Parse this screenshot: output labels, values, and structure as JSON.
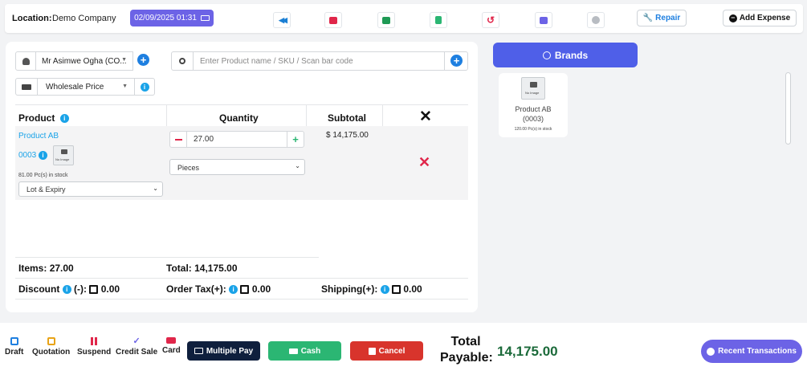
{
  "header": {
    "location_label": "Location:",
    "location_value": "Demo Company",
    "datetime": "02/09/2025 01:31",
    "repair_label": "Repair",
    "add_expense_label": "Add Expense"
  },
  "customer": {
    "selected": "Mr Asimwe Ogha (CO..."
  },
  "search": {
    "placeholder": "Enter Product name / SKU / Scan bar code"
  },
  "price_group": {
    "selected": "Wholesale Price"
  },
  "table": {
    "headers": {
      "product": "Product",
      "quantity": "Quantity",
      "subtotal": "Subtotal"
    },
    "rows": [
      {
        "name": "Product AB",
        "sku": "0003",
        "no_image": "No Image",
        "stock": "81.00 Pc(s) in stock",
        "lot": "Lot & Expiry",
        "quantity": "27.00",
        "unit": "Pieces",
        "subtotal": "$ 14,175.00"
      }
    ]
  },
  "summary": {
    "items_label": "Items:",
    "items_value": "27.00",
    "total_label": "Total:",
    "total_value": "14,175.00",
    "discount_label": "Discount",
    "discount_suffix": "(-):",
    "discount_value": "0.00",
    "tax_label": "Order Tax(+):",
    "tax_value": "0.00",
    "shipping_label": "Shipping(+):",
    "shipping_value": "0.00"
  },
  "brands": {
    "button_label": "Brands",
    "products": [
      {
        "name": "Product AB",
        "sku": "(0003)",
        "stock": "120.00 Pc(s) in stock",
        "no_image": "No Image"
      }
    ]
  },
  "footer": {
    "actions": [
      "Draft",
      "Quotation",
      "Suspend",
      "Credit Sale",
      "Card"
    ],
    "multiple_pay": "Multiple Pay",
    "cash": "Cash",
    "cancel": "Cancel",
    "total_payable_line1": "Total",
    "total_payable_line2": "Payable:",
    "total_payable_value": "14,175.00",
    "recent_transactions": "Recent Transactions"
  },
  "colors": {
    "accent_purple": "#6c63e6",
    "brand_blue": "#4f5fe8",
    "link_blue": "#1aa3e8",
    "danger": "#e0264a",
    "success": "#2bb673",
    "cancel_red": "#d8342c",
    "dark_navy": "#0f1f3d",
    "total_green": "#1b6a3a"
  },
  "icons": [
    "rewind-icon",
    "close-square-icon",
    "briefcase-icon",
    "calculator-icon",
    "undo-icon",
    "card-icon",
    "circle-icon",
    "wrench-icon",
    "minus-circle-icon",
    "user-icon",
    "search-icon",
    "money-icon",
    "info-icon",
    "camera-icon",
    "plus-icon",
    "minus-icon",
    "x-icon",
    "edit-icon",
    "clock-icon"
  ]
}
